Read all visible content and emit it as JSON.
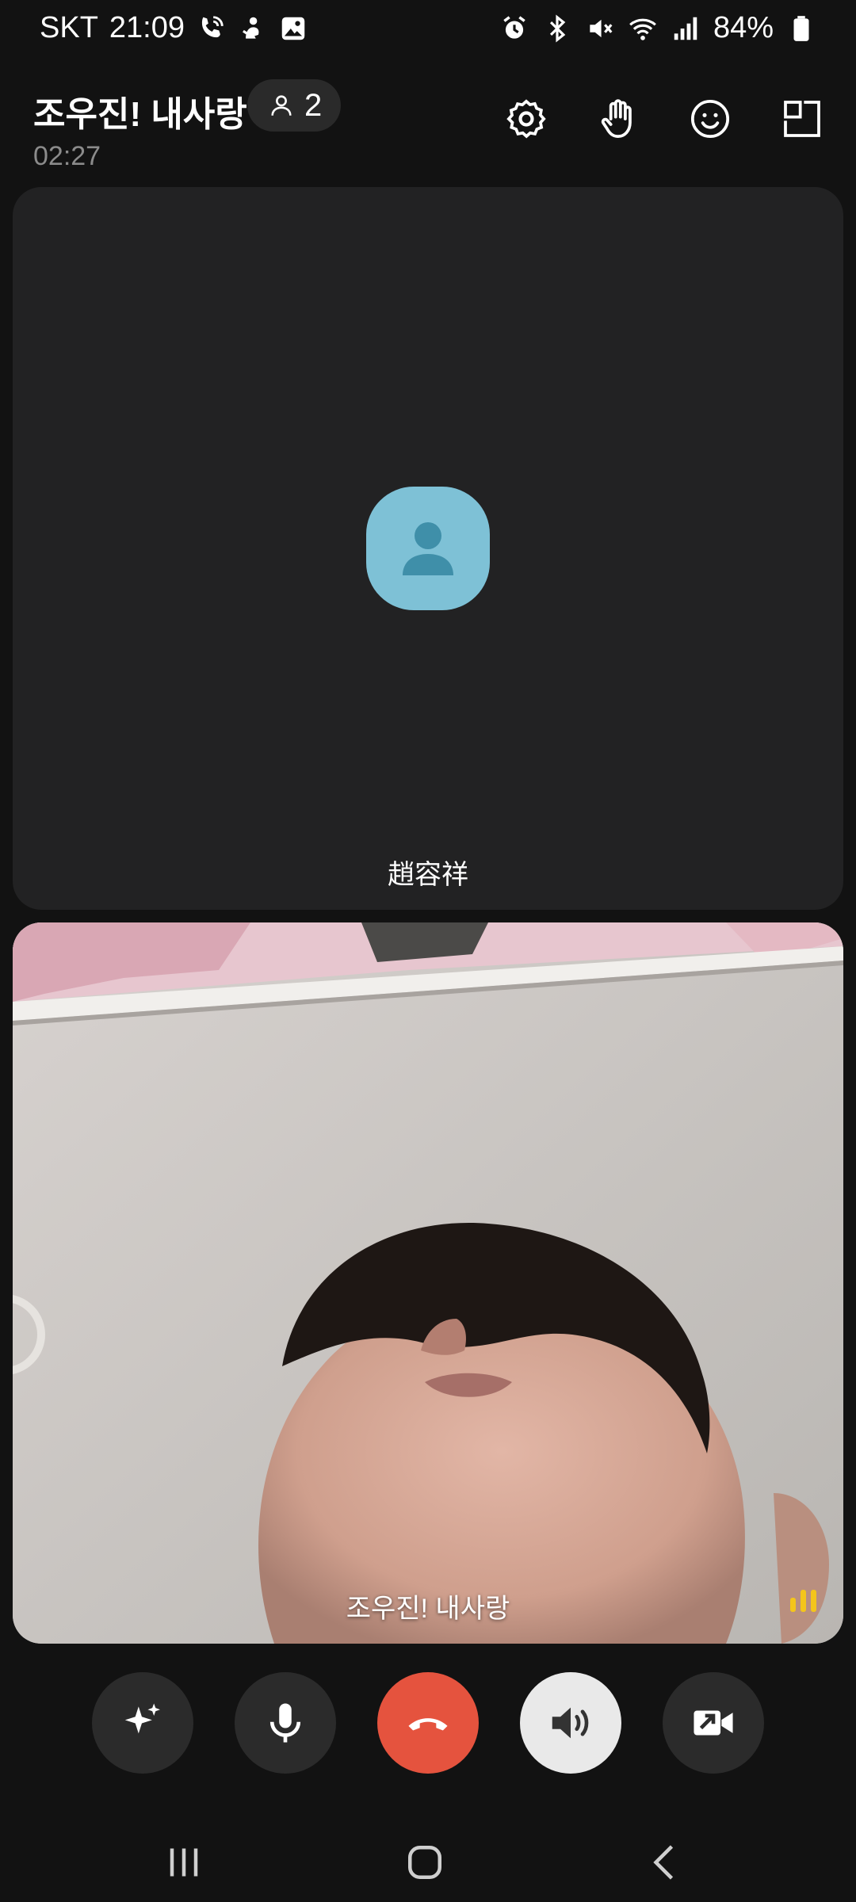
{
  "status_bar": {
    "carrier": "SKT",
    "time": "21:09",
    "battery_percent": "84%",
    "left_icons": [
      "wifi-call-icon",
      "notification-app-icon",
      "gallery-icon"
    ],
    "right_icons": [
      "alarm-icon",
      "bluetooth-icon",
      "mute-icon",
      "wifi-icon",
      "signal-icon",
      "battery-icon"
    ]
  },
  "header": {
    "call_title": "조우진! 내사랑",
    "participant_count": "2",
    "call_duration": "02:27",
    "actions": [
      "settings-icon",
      "raise-hand-icon",
      "emoji-reaction-icon",
      "layout-icon"
    ]
  },
  "tiles": {
    "remote": {
      "name": "趙容祥",
      "camera_off": true
    },
    "local": {
      "name": "조우진! 내사랑",
      "speaking": true
    }
  },
  "controls": {
    "buttons": [
      "effects-icon",
      "microphone-icon",
      "end-call-icon",
      "speaker-icon",
      "switch-video-icon"
    ],
    "end_call_color": "#e5533e",
    "speaker_active": true
  },
  "colors": {
    "background": "#121212",
    "tile_background": "#222223",
    "avatar_color": "#7ec1d6",
    "speaking_indicator": "#f4c51b"
  }
}
